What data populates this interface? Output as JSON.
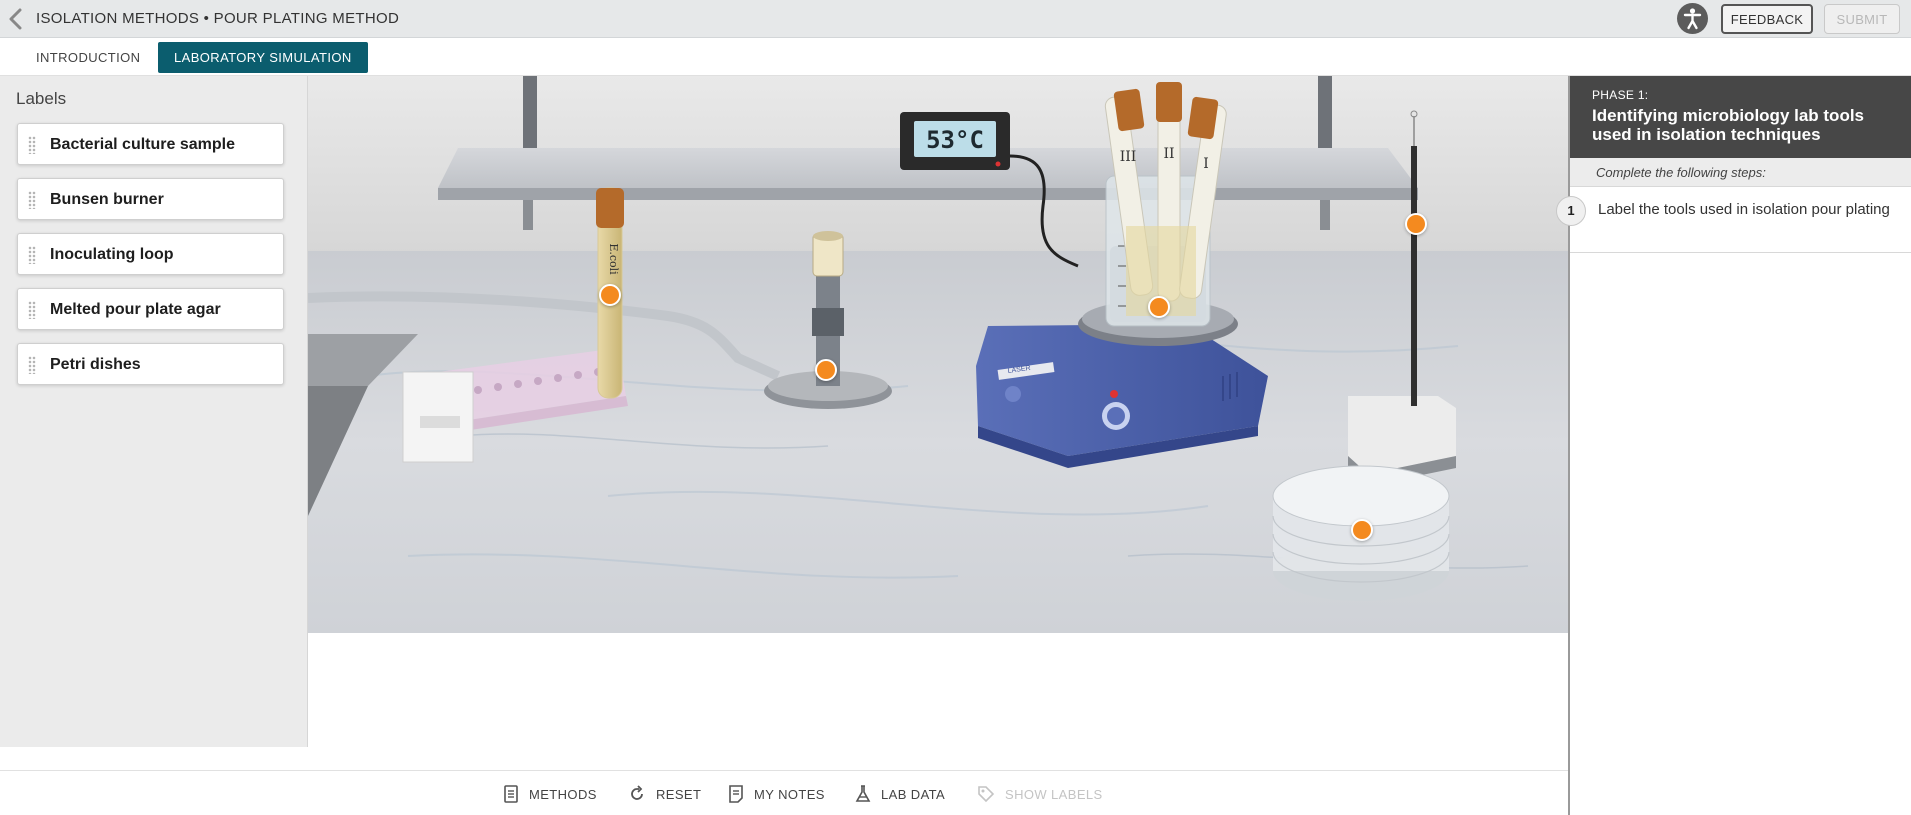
{
  "header": {
    "title": "ISOLATION METHODS • POUR PLATING METHOD",
    "feedback_label": "FEEDBACK",
    "submit_label": "SUBMIT"
  },
  "tabs": [
    {
      "label": "INTRODUCTION",
      "active": false
    },
    {
      "label": "LABORATORY SIMULATION",
      "active": true
    }
  ],
  "labels_panel": {
    "heading": "Labels",
    "items": [
      {
        "label": "Bacterial culture sample"
      },
      {
        "label": "Bunsen burner"
      },
      {
        "label": "Inoculating loop"
      },
      {
        "label": "Melted pour plate agar"
      },
      {
        "label": "Petri dishes"
      }
    ]
  },
  "scene": {
    "thermometer_reading": "53°C",
    "tube_label": "E.coli",
    "tube_marks": [
      "III",
      "II",
      "I"
    ],
    "hotplate_brand": "LASER",
    "accent_color": "#f48a1f"
  },
  "right_panel": {
    "phase_label": "PHASE 1:",
    "phase_title": "Identifying microbiology lab tools used in isolation techniques",
    "steps_intro": "Complete the following steps:",
    "steps": [
      {
        "number": "1",
        "text": "Label the tools used in isolation pour plating"
      }
    ]
  },
  "toolbar": {
    "methods": "METHODS",
    "reset": "RESET",
    "my_notes": "MY NOTES",
    "lab_data": "LAB DATA",
    "show_labels": "SHOW LABELS"
  },
  "colors": {
    "tab_active": "#0b5d6e",
    "hotspot": "#f48a1f",
    "phase_bg": "#474747"
  }
}
